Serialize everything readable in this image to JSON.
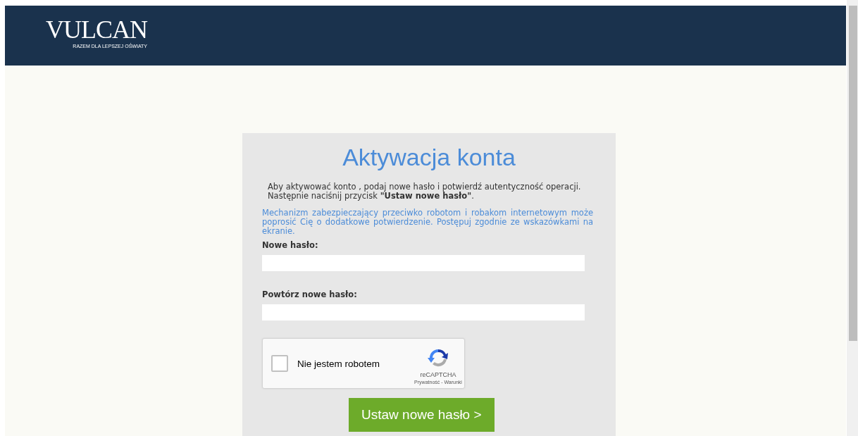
{
  "header": {
    "logo": "VULCAN",
    "tagline": "RAZEM DLA LEPSZEJ OŚWIATY"
  },
  "form": {
    "title": "Aktywacja konta",
    "intro": "Aby aktywować konto , podaj nowe hasło i potwierdź autentyczność operacji. Następnie naciśnij przycisk **\"Ustaw nowe hasło\"**.",
    "notice": "Mechanizm zabezpieczający przeciwko robotom i robakom internetowym może poprosić Cię o dodatkowe potwierdzenie. Postępuj zgodnie ze wskazówkami na ekranie.",
    "fields": [
      {
        "label": "Nowe hasło:"
      },
      {
        "label": "Powtórz nowe hasło:"
      }
    ],
    "captcha": {
      "label": "Nie jestem robotem",
      "checked": false,
      "brand": "reCAPTCHA",
      "links": "Prywatność - Warunki"
    },
    "submit": "Ustaw nowe hasło >"
  }
}
